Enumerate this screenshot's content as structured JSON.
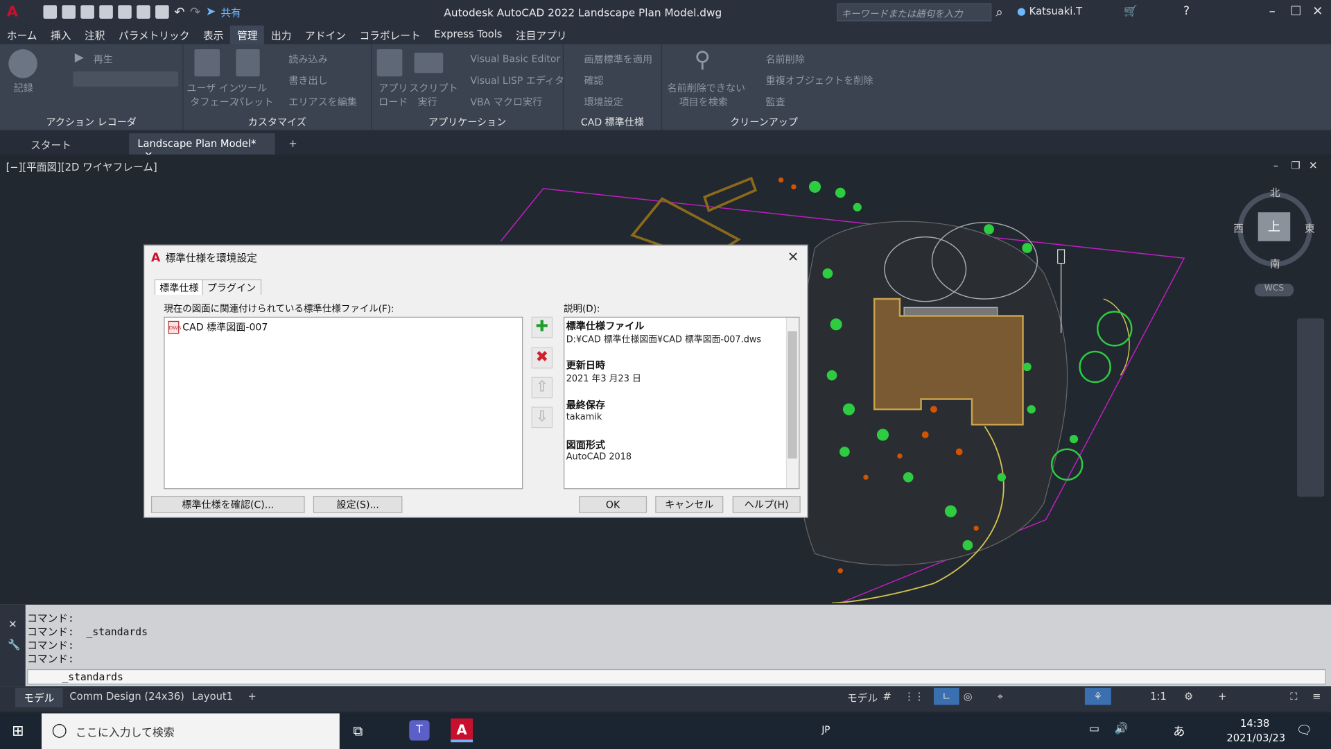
{
  "window": {
    "title": "Autodesk AutoCAD 2022    Landscape Plan Model.dwg",
    "share_label": "共有"
  },
  "search": {
    "placeholder": "キーワードまたは語句を入力"
  },
  "user": {
    "name": "Katsuaki.T"
  },
  "menu": [
    "ホーム",
    "挿入",
    "注釈",
    "パラメトリック",
    "表示",
    "管理",
    "出力",
    "アドイン",
    "コラボレート",
    "Express Tools",
    "注目アプリ"
  ],
  "menu_active": "管理",
  "ribbon": {
    "action_recorder": {
      "title": "アクション レコーダ",
      "record": "記録",
      "play": "再生"
    },
    "customize": {
      "title": "カスタマイズ",
      "ui_line1": "ユーザ イン",
      "ui_line2": "タフェース",
      "tool_line1": "ツール",
      "tool_line2": "パレット",
      "import": "読み込み",
      "export": "書き出し",
      "edit_alias": "エリアスを編集"
    },
    "applications": {
      "title": "アプリケーション",
      "app_line1": "アプリ",
      "app_line2": "ロード",
      "script_line1": "スクリプト",
      "script_line2": "実行",
      "vbe": "Visual Basic Editor",
      "vlisp": "Visual LISP エディタ",
      "vba": "VBA マクロ実行"
    },
    "cad_standards": {
      "title": "CAD 標準仕様",
      "apply_layer": "画層標準を適用",
      "check": "確認",
      "configure": "環境設定"
    },
    "cleanup": {
      "title": "クリーンアップ",
      "purge_find_line1": "名前削除できない",
      "purge_find_line2": "項目を検索",
      "purge": "名前削除",
      "overkill": "重複オブジェクトを削除",
      "audit": "監査"
    }
  },
  "doctabs": {
    "start": "スタート",
    "active": "Landscape Plan Model*",
    "add": "+"
  },
  "viewport": {
    "label": "[−][平面図][2D ワイヤフレーム]",
    "compass": {
      "n": "北",
      "s": "南",
      "e": "東",
      "w": "西",
      "top": "上"
    },
    "wcs": "WCS"
  },
  "dialog": {
    "title": "標準仕様を環境設定",
    "tabs": [
      "標準仕様",
      "プラグイン"
    ],
    "list_label": "現在の図面に関連付けられている標準仕様ファイル(F):",
    "files": [
      "CAD 標準図面-007"
    ],
    "desc_label": "説明(D):",
    "description": [
      {
        "heading": "標準仕様ファイル",
        "value": "D:¥CAD 標準仕様図面¥CAD 標準図面-007.dws"
      },
      {
        "heading": "更新日時",
        "value": "2021 年3 月23 日"
      },
      {
        "heading": "最終保存",
        "value": "takamik"
      },
      {
        "heading": "図面形式",
        "value": "AutoCAD 2018"
      }
    ],
    "buttons": {
      "check": "標準仕様を確認(C)...",
      "settings": "設定(S)...",
      "ok": "OK",
      "cancel": "キャンセル",
      "help": "ヘルプ(H)"
    }
  },
  "command": {
    "history": "コマンド:\nコマンド:  _standards\nコマンド:\nコマンド:",
    "input": "_standards"
  },
  "layout_tabs": [
    "モデル",
    "Comm Design (24x36)",
    "Layout1"
  ],
  "status": {
    "model": "モデル",
    "scale": "1:1"
  },
  "taskbar": {
    "search": "ここに入力して検索",
    "lang": "JP",
    "ime": "あ",
    "time": "14:38",
    "date": "2021/03/23"
  },
  "colors": {
    "accent": "#3e4757",
    "dialog_bg": "#f0f0f0",
    "plan_green": "#2ecc40",
    "plan_orange": "#d35400",
    "building": "#7a5a32"
  }
}
